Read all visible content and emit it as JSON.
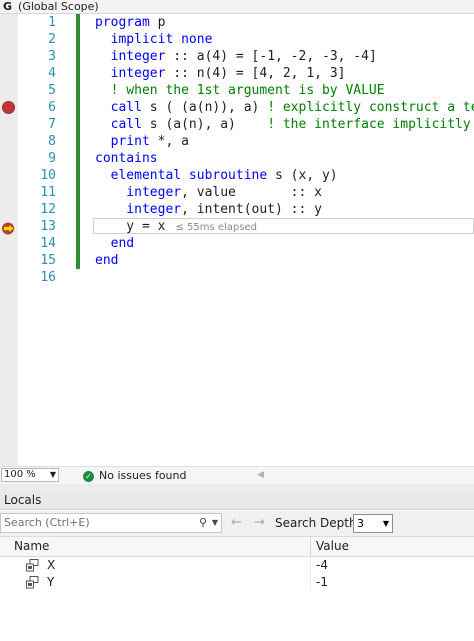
{
  "scope_bar": {
    "glyph": "G",
    "scope": "(Global Scope)"
  },
  "editor": {
    "code_lines": [
      {
        "n": "1",
        "segs": [
          {
            "t": "program",
            "c": "kw"
          },
          {
            "t": " p",
            "c": "tx"
          }
        ]
      },
      {
        "n": "2",
        "segs": [
          {
            "t": "  implicit none",
            "c": "kw"
          }
        ]
      },
      {
        "n": "3",
        "segs": [
          {
            "t": "  integer",
            "c": "kw"
          },
          {
            "t": " :: a(4) = [-1, -2, -3, -4]",
            "c": "tx"
          }
        ]
      },
      {
        "n": "4",
        "segs": [
          {
            "t": "  integer",
            "c": "kw"
          },
          {
            "t": " :: n(4) = [4, 2, 1, 3]",
            "c": "tx"
          }
        ]
      },
      {
        "n": "5",
        "segs": [
          {
            "t": "  ! when the 1st argument is by VALUE",
            "c": "cm"
          }
        ]
      },
      {
        "n": "6",
        "segs": [
          {
            "t": "  call",
            "c": "kw"
          },
          {
            "t": " s ( (a(n)), a) ",
            "c": "tx"
          },
          {
            "t": "! explicitly construct a tem",
            "c": "cm"
          }
        ]
      },
      {
        "n": "7",
        "segs": [
          {
            "t": "  call",
            "c": "kw"
          },
          {
            "t": " s (a(n), a)    ",
            "c": "tx"
          },
          {
            "t": "! the interface implicitly c",
            "c": "cm"
          }
        ]
      },
      {
        "n": "8",
        "segs": [
          {
            "t": "  print",
            "c": "kw"
          },
          {
            "t": " *, a",
            "c": "tx"
          }
        ]
      },
      {
        "n": "9",
        "segs": [
          {
            "t": "contains",
            "c": "kw"
          }
        ]
      },
      {
        "n": "10",
        "segs": [
          {
            "t": "  elemental subroutine",
            "c": "kw"
          },
          {
            "t": " s (x, y)",
            "c": "tx"
          }
        ]
      },
      {
        "n": "11",
        "segs": [
          {
            "t": "    integer",
            "c": "kw"
          },
          {
            "t": ", value       :: x",
            "c": "tx"
          }
        ]
      },
      {
        "n": "12",
        "segs": [
          {
            "t": "    integer",
            "c": "kw"
          },
          {
            "t": ", intent(out) :: y",
            "c": "tx"
          }
        ]
      },
      {
        "n": "13",
        "segs": [
          {
            "t": "    y = x",
            "c": "tx"
          }
        ],
        "elapsed": "≤ 55ms elapsed"
      },
      {
        "n": "14",
        "segs": [
          {
            "t": "  end",
            "c": "kw"
          }
        ]
      },
      {
        "n": "15",
        "segs": [
          {
            "t": "end",
            "c": "kw"
          }
        ]
      },
      {
        "n": "16",
        "segs": []
      }
    ],
    "breakpoint_line": "6",
    "current_line": "13"
  },
  "status_bar": {
    "zoom": "100 %",
    "issues": "No issues found"
  },
  "locals": {
    "title": "Locals",
    "search_placeholder": "Search (Ctrl+E)",
    "search_depth_label": "Search Depth:",
    "search_depth_value": "3",
    "columns": {
      "name": "Name",
      "value": "Value"
    },
    "rows": [
      {
        "name": "X",
        "value": "-4"
      },
      {
        "name": "Y",
        "value": "-1"
      }
    ]
  },
  "colors": {
    "keyword": "#0000ff",
    "comment": "#008000",
    "line_number": "#2b91af",
    "breakpoint": "#c5343c",
    "change_bar": "#2f8f32"
  }
}
